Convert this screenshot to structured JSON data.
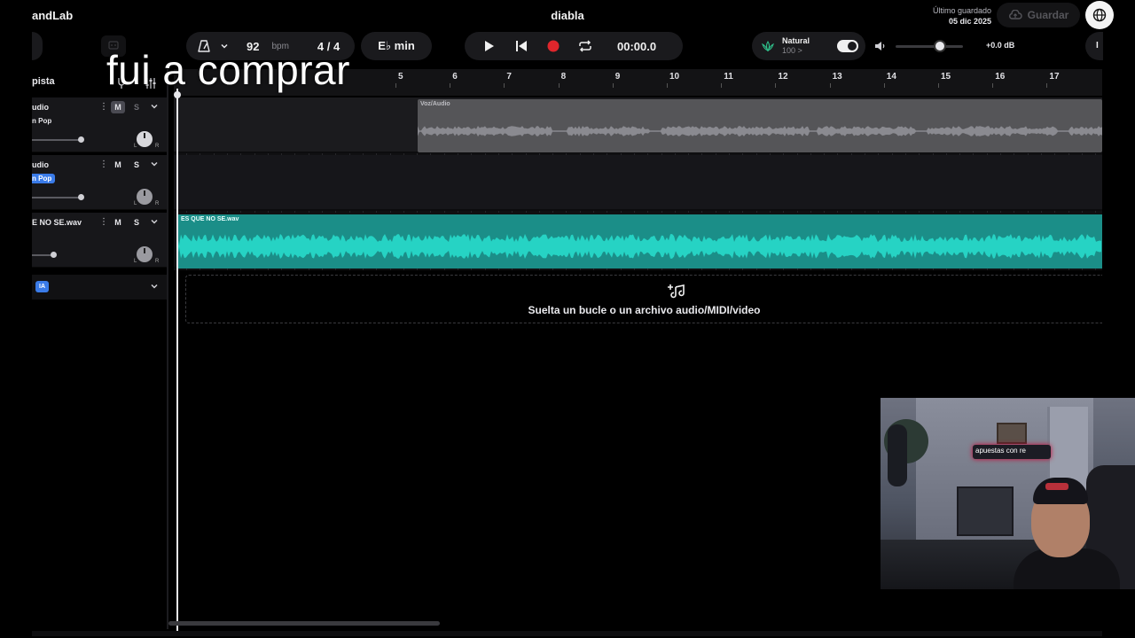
{
  "app": {
    "brand": "andLab",
    "project_title": "diabla"
  },
  "saved": {
    "label": "Último guardado",
    "date": "05 dic 2025",
    "save_button": "Guardar"
  },
  "toolbar": {
    "bpm": "92",
    "bpm_unit": "bpm",
    "time_signature": "4 / 4",
    "key": "E♭ min",
    "time_display": "00:00.0",
    "fx_name": "Natural",
    "fx_value": "100 >",
    "master_volume": "+0.0 dB",
    "right_stub": "I"
  },
  "tracks_header": {
    "add_track": "pista"
  },
  "ruler": {
    "bars": [
      "5",
      "6",
      "7",
      "8",
      "9",
      "10",
      "11",
      "12",
      "13",
      "14",
      "15",
      "16",
      "17"
    ]
  },
  "tracks": [
    {
      "name": "udio",
      "preset": "n Pop",
      "mute": "M",
      "solo": "S",
      "mute_active": true
    },
    {
      "name": "udio",
      "preset": "n Pop",
      "mute": "M",
      "solo": "S",
      "mute_active": false
    },
    {
      "name": "E NO SE.wav",
      "preset": "",
      "mute": "M",
      "solo": "S",
      "mute_active": false
    }
  ],
  "knob_labels": {
    "left": "L",
    "right": "R"
  },
  "ia_row": {
    "badge": "IA"
  },
  "clips": {
    "voz": "Voz/Audio",
    "es": "ES QUE NO SE.wav"
  },
  "drop_zone": {
    "text": "Suelta un bucle o un archivo audio/MIDI/video"
  },
  "caption": "fui a comprar",
  "webcam": {
    "sign": "apuestas con re"
  },
  "colors": {
    "accent_blue": "#3a7be8",
    "audio_clip": "#1b8e88",
    "record": "#e0262c",
    "voz_clip": "#555558"
  }
}
